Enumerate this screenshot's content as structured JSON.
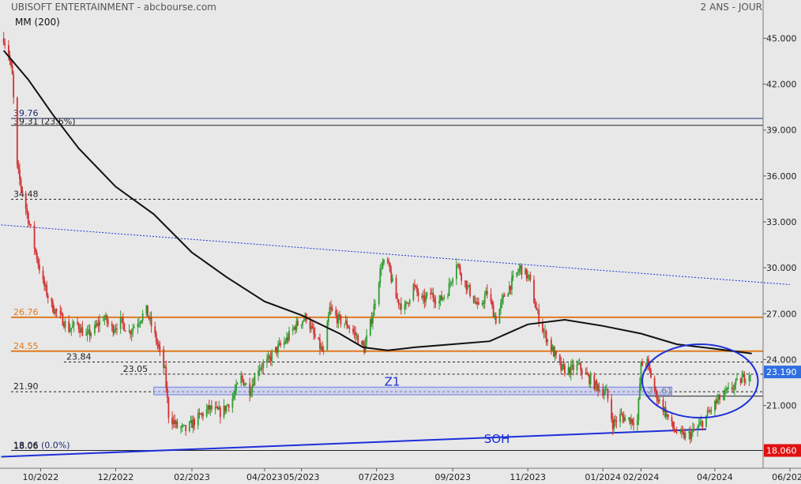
{
  "header": {
    "title": "UBISOFT ENTERTAINMENT - abcbourse.com",
    "period": "2 ANS - JOUR",
    "ma_label": "MM (200)"
  },
  "colors": {
    "background": "#e8e8e8",
    "up": "#2f9e2f",
    "down": "#d43030",
    "orange_level": "#e07a1f",
    "blue": "#1c2fd8",
    "navy": "#1c2a6e",
    "ma": "#111111"
  },
  "chart_data": {
    "type": "candlestick",
    "title": "UBISOFT ENTERTAINMENT - abcbourse.com",
    "period": "2 ANS - JOUR",
    "xlabel": "",
    "ylabel": "",
    "ylim": [
      16.9,
      47.5
    ],
    "xlim": [
      "2022-08-29",
      "2024-06-10"
    ],
    "grid": false,
    "x_ticks": [
      {
        "label": "10/2022",
        "date": "2022-10-01"
      },
      {
        "label": "12/2022",
        "date": "2022-12-01"
      },
      {
        "label": "02/2023",
        "date": "2023-02-01"
      },
      {
        "label": "04/2023",
        "date": "2023-04-01"
      },
      {
        "label": "05/2023",
        "date": "2023-05-01"
      },
      {
        "label": "07/2023",
        "date": "2023-07-01"
      },
      {
        "label": "09/2023",
        "date": "2023-09-01"
      },
      {
        "label": "11/2023",
        "date": "2023-11-01"
      },
      {
        "label": "01/2024",
        "date": "2024-01-01"
      },
      {
        "label": "02/2024",
        "date": "2024-02-01"
      },
      {
        "label": "04/2024",
        "date": "2024-04-01"
      },
      {
        "label": "06/2024",
        "date": "2024-06-01"
      }
    ],
    "y_ticks": [
      45.0,
      42.0,
      39.0,
      36.0,
      33.0,
      30.0,
      27.0,
      24.0,
      21.0
    ],
    "y_tick_labels": [
      "45.000",
      "42.000",
      "39.000",
      "36.000",
      "33.000",
      "30.000",
      "27.000",
      "24.000",
      "21.000"
    ],
    "last_price": {
      "value": 23.19,
      "label": "23.190"
    },
    "low_price": {
      "value": 18.06,
      "label": "18.060"
    },
    "price_path": [
      [
        "2022-09-01",
        45.0
      ],
      [
        "2022-09-05",
        44.0
      ],
      [
        "2022-09-08",
        42.5
      ],
      [
        "2022-09-12",
        36.5
      ],
      [
        "2022-09-16",
        35.0
      ],
      [
        "2022-09-21",
        33.2
      ],
      [
        "2022-09-27",
        31.0
      ],
      [
        "2022-10-03",
        29.0
      ],
      [
        "2022-10-10",
        27.5
      ],
      [
        "2022-10-17",
        26.8
      ],
      [
        "2022-10-24",
        26.0
      ],
      [
        "2022-10-31",
        26.3
      ],
      [
        "2022-11-07",
        25.5
      ],
      [
        "2022-11-14",
        26.0
      ],
      [
        "2022-11-21",
        26.8
      ],
      [
        "2022-11-28",
        26.0
      ],
      [
        "2022-12-05",
        26.5
      ],
      [
        "2022-12-12",
        25.8
      ],
      [
        "2022-12-19",
        26.5
      ],
      [
        "2022-12-26",
        27.2
      ],
      [
        "2023-01-04",
        25.0
      ],
      [
        "2023-01-10",
        23.2
      ],
      [
        "2023-01-13",
        20.4
      ],
      [
        "2023-01-20",
        19.6
      ],
      [
        "2023-01-27",
        19.4
      ],
      [
        "2023-02-06",
        20.2
      ],
      [
        "2023-02-15",
        20.8
      ],
      [
        "2023-02-25",
        20.5
      ],
      [
        "2023-03-06",
        21.5
      ],
      [
        "2023-03-13",
        22.8
      ],
      [
        "2023-03-20",
        22.0
      ],
      [
        "2023-03-27",
        23.5
      ],
      [
        "2023-04-03",
        23.8
      ],
      [
        "2023-04-10",
        24.6
      ],
      [
        "2023-04-18",
        25.2
      ],
      [
        "2023-04-26",
        26.2
      ],
      [
        "2023-05-05",
        26.8
      ],
      [
        "2023-05-12",
        25.4
      ],
      [
        "2023-05-19",
        24.4
      ],
      [
        "2023-05-24",
        27.3
      ],
      [
        "2023-05-31",
        26.6
      ],
      [
        "2023-06-07",
        26.3
      ],
      [
        "2023-06-14",
        25.6
      ],
      [
        "2023-06-21",
        24.7
      ],
      [
        "2023-06-28",
        27.0
      ],
      [
        "2023-07-05",
        30.2
      ],
      [
        "2023-07-10",
        30.3
      ],
      [
        "2023-07-17",
        28.0
      ],
      [
        "2023-07-24",
        27.3
      ],
      [
        "2023-07-31",
        28.8
      ],
      [
        "2023-08-07",
        27.8
      ],
      [
        "2023-08-14",
        28.3
      ],
      [
        "2023-08-21",
        27.8
      ],
      [
        "2023-08-28",
        28.5
      ],
      [
        "2023-09-04",
        30.4
      ],
      [
        "2023-09-08",
        29.5
      ],
      [
        "2023-09-15",
        28.4
      ],
      [
        "2023-09-22",
        27.3
      ],
      [
        "2023-09-29",
        28.4
      ],
      [
        "2023-10-06",
        26.6
      ],
      [
        "2023-10-13",
        28.2
      ],
      [
        "2023-10-20",
        29.2
      ],
      [
        "2023-10-26",
        30.0
      ],
      [
        "2023-11-02",
        29.3
      ],
      [
        "2023-11-08",
        27.2
      ],
      [
        "2023-11-14",
        25.8
      ],
      [
        "2023-11-21",
        24.6
      ],
      [
        "2023-11-28",
        23.4
      ],
      [
        "2023-12-05",
        23.3
      ],
      [
        "2023-12-12",
        23.6
      ],
      [
        "2023-12-19",
        22.9
      ],
      [
        "2023-12-26",
        22.3
      ],
      [
        "2024-01-04",
        21.8
      ],
      [
        "2024-01-09",
        19.8
      ],
      [
        "2024-01-15",
        20.3
      ],
      [
        "2024-01-22",
        20.1
      ],
      [
        "2024-01-29",
        20.0
      ],
      [
        "2024-02-01",
        23.6
      ],
      [
        "2024-02-06",
        23.8
      ],
      [
        "2024-02-13",
        21.7
      ],
      [
        "2024-02-20",
        20.7
      ],
      [
        "2024-02-27",
        19.5
      ],
      [
        "2024-03-05",
        19.0
      ],
      [
        "2024-03-12",
        19.1
      ],
      [
        "2024-03-19",
        19.6
      ],
      [
        "2024-03-26",
        20.4
      ],
      [
        "2024-04-03",
        21.3
      ],
      [
        "2024-04-10",
        21.8
      ],
      [
        "2024-04-17",
        22.3
      ],
      [
        "2024-04-24",
        22.8
      ],
      [
        "2024-04-30",
        23.19
      ]
    ],
    "moving_average": {
      "name": "MM (200)",
      "points": [
        [
          "2022-09-01",
          44.2
        ],
        [
          "2022-09-21",
          42.3
        ],
        [
          "2022-10-11",
          40.0
        ],
        [
          "2022-11-01",
          37.8
        ],
        [
          "2022-12-01",
          35.3
        ],
        [
          "2023-01-01",
          33.5
        ],
        [
          "2023-02-01",
          31.0
        ],
        [
          "2023-03-01",
          29.4
        ],
        [
          "2023-04-01",
          27.8
        ],
        [
          "2023-05-01",
          26.9
        ],
        [
          "2023-06-01",
          25.7
        ],
        [
          "2023-06-20",
          24.8
        ],
        [
          "2023-07-10",
          24.6
        ],
        [
          "2023-08-01",
          24.8
        ],
        [
          "2023-09-01",
          25.0
        ],
        [
          "2023-10-01",
          25.2
        ],
        [
          "2023-11-01",
          26.3
        ],
        [
          "2023-12-01",
          26.6
        ],
        [
          "2024-01-01",
          26.2
        ],
        [
          "2024-02-01",
          25.7
        ],
        [
          "2024-03-01",
          25.0
        ],
        [
          "2024-04-01",
          24.7
        ],
        [
          "2024-05-01",
          24.4
        ]
      ]
    },
    "horizontal_levels": [
      {
        "label": "39.76",
        "value": 39.76,
        "style": "navy",
        "from": "2022-08-30"
      },
      {
        "label": "39.31  (23.6%)",
        "value": 39.31,
        "style": "black",
        "from": "2022-08-30"
      },
      {
        "label": "34.48",
        "value": 34.48,
        "style": "dashed",
        "from": "2022-08-30"
      },
      {
        "label": "26.76",
        "value": 26.76,
        "style": "orange",
        "from": "2022-08-30"
      },
      {
        "label": "24.55",
        "value": 24.55,
        "style": "orange",
        "from": "2022-08-30"
      },
      {
        "label": "23.84",
        "value": 23.84,
        "style": "dashed",
        "from": "2022-10-20"
      },
      {
        "label": "23.05",
        "value": 23.05,
        "style": "dashed",
        "from": "2022-12-05"
      },
      {
        "label": "21.90",
        "value": 21.9,
        "style": "dashed",
        "from": "2022-08-30"
      },
      {
        "label": "21.61",
        "value": 21.61,
        "style": "solid",
        "from": "2024-02-05"
      },
      {
        "label": "18.06  (0.0%)",
        "value": 18.06,
        "style": "navy",
        "from": "2022-08-30"
      },
      {
        "label": "18.06",
        "value": 18.06,
        "style": "solid",
        "from": "2022-08-30"
      }
    ],
    "zone": {
      "label": "Z1",
      "from": "2023-01-01",
      "to": "2024-02-26",
      "low": 21.7,
      "high": 22.2
    },
    "trendlines": [
      {
        "name": "resistance",
        "style": "dotted",
        "from": [
          "2022-08-30",
          32.8
        ],
        "to": [
          "2024-06-01",
          28.9
        ]
      },
      {
        "name": "support",
        "label": "SOH",
        "style": "solid",
        "from": [
          "2022-08-30",
          17.65
        ],
        "to": [
          "2024-03-25",
          19.45
        ]
      }
    ],
    "ellipse": {
      "center": [
        "2024-03-20",
        22.6
      ],
      "span_days": 47,
      "half_height": 2.4
    }
  }
}
